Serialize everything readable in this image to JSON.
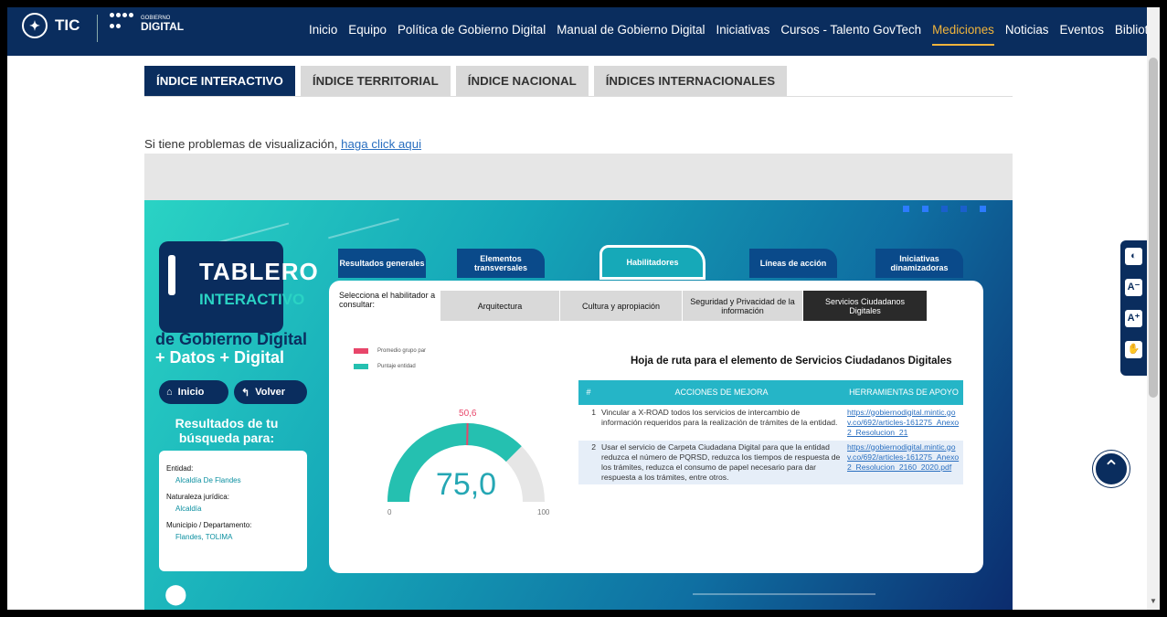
{
  "navbar": {
    "brand_tic": "TIC",
    "brand_gd_top": "GOBIERNO",
    "brand_gd_bottom": "DIGITAL",
    "links": [
      "Inicio",
      "Equipo",
      "Política de Gobierno Digital",
      "Manual de Gobierno Digital",
      "Iniciativas",
      "Cursos - Talento GovTech",
      "Mediciones",
      "Noticias",
      "Eventos",
      "Biblioteca"
    ],
    "active_link": "Mediciones"
  },
  "tabs": [
    "ÍNDICE INTERACTIVO",
    "ÍNDICE TERRITORIAL",
    "ÍNDICE NACIONAL",
    "ÍNDICES INTERNACIONALES"
  ],
  "notice": {
    "text": "Si tiene problemas de visualización, ",
    "link": "haga click aqui"
  },
  "dashboard": {
    "logo_title": "TABLERO",
    "logo_sub": "INTERACTIVO",
    "subtitle1": "de Gobierno Digital",
    "subtitle2": "+ Datos + Digital",
    "btn_home": "Inicio",
    "btn_back": "Volver",
    "results_title": "Resultados de tu búsqueda para:",
    "results": {
      "entidad_label": "Entidad:",
      "entidad_value": "Alcaldía De Flandes",
      "naturaleza_label": "Naturaleza jurídica:",
      "naturaleza_value": "Alcaldía",
      "municipio_label": "Municipio / Departamento:",
      "municipio_value": "Flandes, TOLIMA"
    },
    "section_tabs": [
      "Resultados generales",
      "Elementos transversales",
      "Habilitadores",
      "Líneas de acción",
      "Iniciativas dinamizadoras"
    ],
    "active_section": "Habilitadores",
    "selector_label": "Selecciona el habilitador a consultar:",
    "selector_options": [
      "Arquitectura",
      "Cultura y apropiación",
      "Seguridad y Privacidad de la información",
      "Servicios Ciudadanos Digitales"
    ],
    "selector_active": "Servicios Ciudadanos Digitales",
    "legend": [
      {
        "label": "Promedio grupo par",
        "color": "#e8466a"
      },
      {
        "label": "Puntaje entidad",
        "color": "#25c0b0"
      }
    ],
    "gauge": {
      "value_label": "75,0",
      "value": 75.0,
      "peer_label": "50,6",
      "peer": 50.6,
      "min": "0",
      "max": "100"
    },
    "roadmap_title": "Hoja de ruta para el elemento de Servicios Ciudadanos Digitales",
    "roadmap_headers": [
      "#",
      "ACCIONES DE MEJORA",
      "HERRAMIENTAS DE APOYO"
    ],
    "roadmap_rows": [
      {
        "num": "1",
        "action": "Vincular a X-ROAD todos los servicios de intercambio de información requeridos para la realización de trámites de la entidad.",
        "link": "https://gobiernodigital.mintic.gov.co/692/articles-161275_Anexo2_Resolucion_21"
      },
      {
        "num": "2",
        "action": "Usar el servicio de Carpeta Ciudadana Digital para que la entidad reduzca el número de PQRSD, reduzca los tiempos de respuesta de los trámites, reduzca el consumo de papel necesario para dar respuesta a los trámites, entre otros.",
        "link": "https://gobiernodigital.mintic.gov.co/692/articles-161275_Anexo2_Resolucion_2160_2020.pdf"
      }
    ]
  },
  "colors": {
    "navy": "#0a2d5e",
    "teal": "#25c0b0",
    "peer": "#e8466a",
    "active_nav": "#f0b43c"
  }
}
